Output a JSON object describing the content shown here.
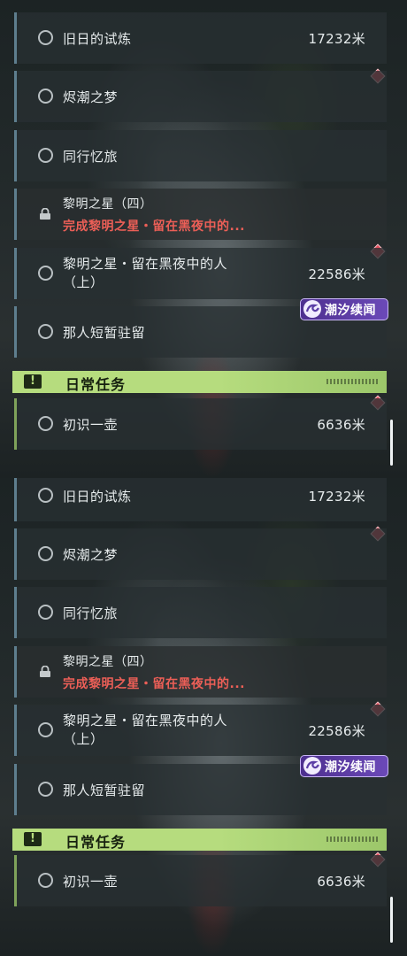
{
  "quests": {
    "trial_of_past": {
      "title": "旧日的试炼",
      "distance": "17232米"
    },
    "ember_tide_dream": {
      "title": "烬潮之梦"
    },
    "companion_journey": {
      "title": "同行忆旅"
    },
    "star_of_dawn_4": {
      "title": "黎明之星（四）",
      "requirement": "完成黎明之星・留在黑夜中的..."
    },
    "star_of_dawn_night": {
      "title_line1": "黎明之星・留在黑夜中的人",
      "title_line2": "（上）",
      "distance": "22586米"
    },
    "that_person_stays": {
      "title": "那人短暂驻留"
    },
    "first_pot": {
      "title": "初识一壶",
      "distance": "6636米"
    }
  },
  "sections": {
    "daily_header": "日常任务"
  },
  "badges": {
    "event_label": "潮汐续闻"
  },
  "icons": {
    "incomplete": "empty-circle-icon",
    "locked": "lock-icon",
    "tracked": "red-diamond-icon",
    "daily": "exclamation-box-icon",
    "event": "tide-swirl-icon"
  },
  "colors": {
    "row_accent": "#5e7e8e",
    "daily_accent": "#b6dc7e",
    "warning_text": "#ec5f57",
    "marker": "#e24d5c",
    "event_badge": "#6b49b8"
  }
}
